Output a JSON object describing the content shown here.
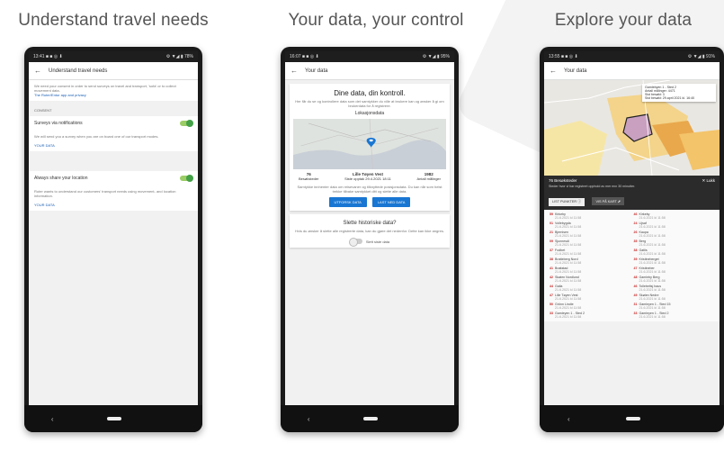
{
  "headings": [
    "Understand travel needs",
    "Your data, your control",
    "Explore your data"
  ],
  "phone1": {
    "status": {
      "left": "13:41 ■ ■ ◎ ⬇",
      "right": "⚙ ▼◢ ▮ 78%"
    },
    "appbar_title": "Understand travel needs",
    "intro": "We need your consent in order to send surveys on travel and transport, 'sofa' or to collect movement data.",
    "link": "The Ruter/Entur app and privacy",
    "consent_label": "CONSENT",
    "toggle1_label": "Surveys via notifications",
    "toggle1_desc": "We will send you a survey when you are on board one of our transport modes.",
    "your_data1": "YOUR DATA",
    "toggle2_label": "Always share your location",
    "toggle2_desc": "Ruter wants to understand our customers' transport needs using movement- and location information.",
    "your_data2": "YOUR DATA"
  },
  "phone2": {
    "status": {
      "left": "16:07 ■ ■ ◎ ⬇",
      "right": "⚙ ▼◢ ▮ 95%"
    },
    "appbar_title": "Your data",
    "card_title": "Dine data, din kontroll.",
    "card_body": "Her får du se og kontrollere data som det samtykker du ville at brukere kan og ønsker å gi om brukerdata for å registrere.",
    "map_label": "Lokasjonsdata",
    "stats": [
      {
        "value": "76",
        "label": "Besøksteder"
      },
      {
        "value": "Lille Tøyen Vest",
        "label": "Siste opptak 29.4.2021 18:11"
      },
      {
        "value": "1982",
        "label": "Antall målinger"
      }
    ],
    "card_fine": "Samtykke innhenter data om reisevaner og tilknyttede posisjonsdata. Du kan når som helst trekke tilbake samtykket ditt og slette alle data.",
    "btn_explore": "UTFORSK DATA",
    "btn_delete": "LAST NED DATA",
    "history_title": "Slette historiske data?",
    "history_body": "Hvis du ønsker å slette alle registrerte data, kan du gjøre det nedenfor. Dette kan ikke angres.",
    "history_toggle": "Slett siste data"
  },
  "phone3": {
    "status": {
      "left": "13:55 ■ ■ ◎ ⬇",
      "right": "⚙ ▼◢ ▮ 91%"
    },
    "appbar_title": "Your data",
    "popup": [
      "Gamlebyen 1 - Sted 2",
      "Antall målinger: 4471",
      "Sist besøkt: 3",
      "Sist besøkt: 29.april 2021 kl. 16:40"
    ],
    "dark_title": "76 Besøksteder",
    "dark_close": "✕ Lukk",
    "dark_desc": "Steder hvor vi har registrert opphold av mer enn 30 minutter.",
    "btn_a": "LIST PUNKTER ⓘ",
    "btn_b": "VIS PÅ KART ⬈",
    "list": [
      {
        "n": "59",
        "name": "Kirkeby",
        "sub": "21.6.2021 kl 11:58"
      },
      {
        "n": "46",
        "name": "Kirkeby",
        "sub": "21.6.2021 kl 11:58"
      },
      {
        "n": "01",
        "name": "Vollebygda",
        "sub": "21.6.2021 kl 11:58"
      },
      {
        "n": "24",
        "name": "Lijsaf",
        "sub": "21.6.2021 kl 11:58"
      },
      {
        "n": "21",
        "name": "Bjernisen",
        "sub": "21.6.2021 kl 11:58"
      },
      {
        "n": "26",
        "name": "Kaupa",
        "sub": "21.6.2021 kl 11:58"
      },
      {
        "n": "09",
        "name": "Sjunnesdi",
        "sub": "21.6.2021 kl 11:58"
      },
      {
        "n": "35",
        "name": "Berg",
        "sub": "21.6.2021 kl 11:58"
      },
      {
        "n": "37",
        "name": "Fodbet",
        "sub": "21.6.2021 kl 11:58"
      },
      {
        "n": "38",
        "name": "Gatlis",
        "sub": "21.6.2021 kl 11:58"
      },
      {
        "n": "38",
        "name": "Bratteberg Nord",
        "sub": "21.6.2021 kl 11:58"
      },
      {
        "n": "39",
        "name": "Kristineberget",
        "sub": "21.6.2021 kl 11:58"
      },
      {
        "n": "41",
        "name": "Brøkstad",
        "sub": "21.6.2021 kl 11:58"
      },
      {
        "n": "47",
        "name": "Kristineber",
        "sub": "21.6.2021 kl 11:58"
      },
      {
        "n": "42",
        "name": "Skøien Nordlund",
        "sub": "21.6.2021 kl 11:58"
      },
      {
        "n": "48",
        "name": "Gamleby Berg",
        "sub": "21.6.2021 kl 11:58"
      },
      {
        "n": "44",
        "name": "Galla",
        "sub": "21.6.2021 kl 11:58"
      },
      {
        "n": "46",
        "name": "Tollebeltsj haus",
        "sub": "21.6.2021 kl 11:58"
      },
      {
        "n": "47",
        "name": "Lille Tøyen Vest",
        "sub": "21.6.2021 kl 11:58"
      },
      {
        "n": "49",
        "name": "Skøien Nedre",
        "sub": "21.6.2021 kl 11:58"
      },
      {
        "n": "50",
        "name": "Grönn Lindie",
        "sub": "21.6.2021 kl 11:58"
      },
      {
        "n": "31",
        "name": "Gamleyen 1 - Sted 15",
        "sub": "21.6.2021 kl 11:58"
      },
      {
        "n": "33",
        "name": "Gamleyen 1 - Sted 2",
        "sub": "21.6.2021 kl 11:58"
      },
      {
        "n": "33",
        "name": "Gamleyen 1 - Sted 2",
        "sub": "21.6.2021 kl 11:58"
      }
    ]
  }
}
